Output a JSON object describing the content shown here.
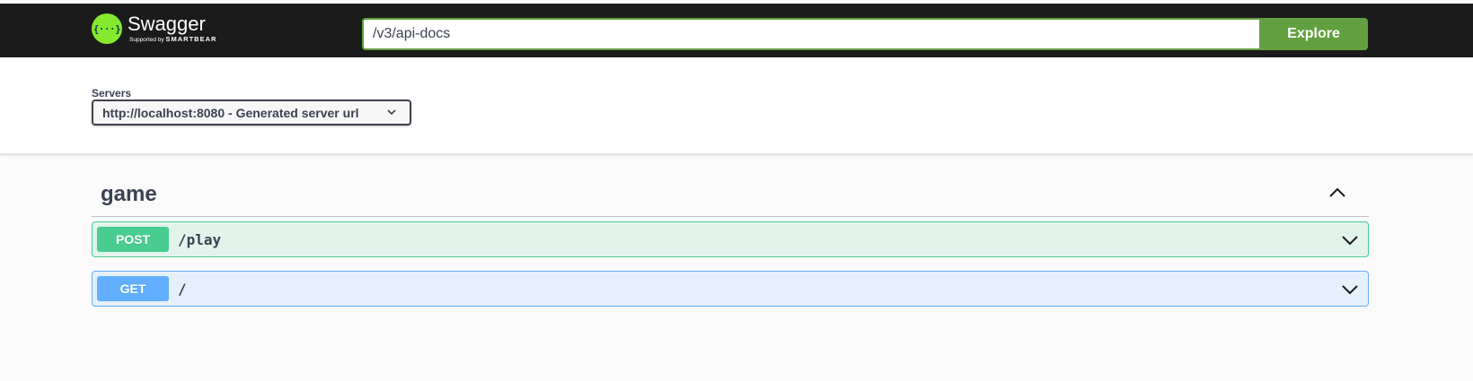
{
  "topbar": {
    "logo_title": "Swagger",
    "logo_mark": "{···}",
    "logo_sub_prefix": "Supported by",
    "logo_sub_brand": "SMARTBEAR",
    "url_value": "/v3/api-docs",
    "explore_label": "Explore"
  },
  "servers": {
    "label": "Servers",
    "selected": "http://localhost:8080 - Generated server url"
  },
  "tag": {
    "name": "game"
  },
  "operations": [
    {
      "method": "POST",
      "path": "/play"
    },
    {
      "method": "GET",
      "path": "/"
    }
  ],
  "colors": {
    "topbar_bg": "#1b1b1b",
    "accent_green": "#62a03f",
    "post": "#49cc90",
    "get": "#61affe"
  }
}
